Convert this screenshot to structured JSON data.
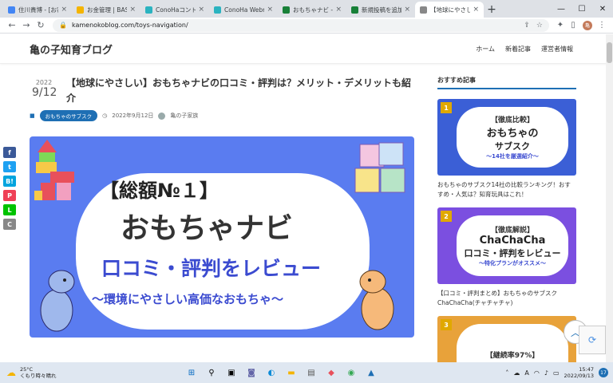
{
  "browser": {
    "tabs": [
      {
        "title": "住川貴博 - [お客",
        "color": "#4285f4"
      },
      {
        "title": "お金管理 | BASE",
        "color": "#f4b400"
      },
      {
        "title": "ConoHaコントロー",
        "color": "#2bb3c0"
      },
      {
        "title": "ConoHa Webm",
        "color": "#2bb3c0"
      },
      {
        "title": "おもちゃナビ - 地球",
        "color": "#188038"
      },
      {
        "title": "新規投稿を追加",
        "color": "#188038"
      },
      {
        "title": "【地球にやさしい】",
        "color": "#888888"
      }
    ],
    "url": "kamenokoblog.com/toys-navigation/",
    "profile_initial": "亀"
  },
  "site": {
    "title": "亀の子知育ブログ",
    "nav": [
      "ホーム",
      "新着記事",
      "運営者情報"
    ]
  },
  "post": {
    "year": "2022",
    "monthday": "9/12",
    "title": "【地球にやさしい】おもちゃナビの口コミ・評判は？メリット・デメリットも紹介",
    "category": "おもちゃのサブスク",
    "date": "2022年9月12日",
    "author": "亀の子家族"
  },
  "eyecatch": {
    "tag": "【総額№１】",
    "main": "おもちゃナビ",
    "sub": "口コミ・評判をレビュー",
    "sub2": "～環境にやさしい高価なおもちゃ～"
  },
  "share": [
    {
      "label": "f",
      "color": "#3b5998"
    },
    {
      "label": "t",
      "color": "#1da1f2"
    },
    {
      "label": "B!",
      "color": "#00a4de"
    },
    {
      "label": "P",
      "color": "#ef4056"
    },
    {
      "label": "L",
      "color": "#00c300"
    },
    {
      "label": "C",
      "color": "#888888"
    }
  ],
  "sidebar": {
    "heading": "おすすめ記事",
    "cards": [
      {
        "rank": "1",
        "color": "#3b5fd6",
        "line1": "【徹底比較】",
        "line2": "おもちゃの",
        "line3": "サブスク",
        "line4": "〜14社を厳選紹介〜",
        "title": "おもちゃのサブスク14社の比較ランキング！おすすめ・人気は？知育玩具はこれ！"
      },
      {
        "rank": "2",
        "color": "#7b4fe0",
        "line1": "【徹底解説】",
        "line2": "ChaChaCha",
        "line3": "口コミ・評判をレビュー",
        "line4": "〜特化プランがオススメ〜",
        "title": "【口コミ・評判まとめ】おもちゃのサブスク ChaChaCha(チャチャチャ)"
      },
      {
        "rank": "3",
        "color": "#e8a23a",
        "line1": "【継続率97%】",
        "line2": "",
        "line3": "",
        "line4": "",
        "title": ""
      }
    ]
  },
  "taskbar": {
    "temp": "25°C",
    "weather": "くもり時々晴れ",
    "time": "15:47",
    "date": "2022/09/13",
    "lang": "A",
    "notifications": "17"
  }
}
